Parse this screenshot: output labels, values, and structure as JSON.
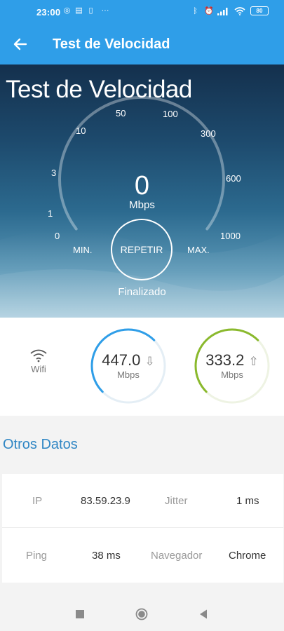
{
  "status_bar": {
    "time": "23:00",
    "battery": "80"
  },
  "app_bar": {
    "title": "Test de Velocidad"
  },
  "hero": {
    "title": "Test de Velocidad",
    "ticks": [
      "0",
      "1",
      "3",
      "10",
      "50",
      "100",
      "300",
      "600",
      "1000"
    ],
    "speed": "0",
    "unit": "Mbps",
    "min_label": "MIN.",
    "max_label": "MAX.",
    "repeat_label": "REPETIR",
    "status": "Finalizado"
  },
  "results": {
    "connection_label": "Wifi",
    "download": {
      "value": "447.0",
      "unit": "Mbps",
      "arrow": "⇩",
      "color": "#2f9ee8",
      "fill_fraction": 0.5
    },
    "upload": {
      "value": "333.2",
      "unit": "Mbps",
      "arrow": "⇧",
      "color": "#8ab92d",
      "fill_fraction": 0.5
    }
  },
  "other": {
    "title": "Otros Datos",
    "rows": [
      {
        "k1": "IP",
        "v1": "83.59.23.9",
        "k2": "Jitter",
        "v2": "1 ms"
      },
      {
        "k1": "Ping",
        "v1": "38 ms",
        "k2": "Navegador",
        "v2": "Chrome"
      }
    ]
  }
}
